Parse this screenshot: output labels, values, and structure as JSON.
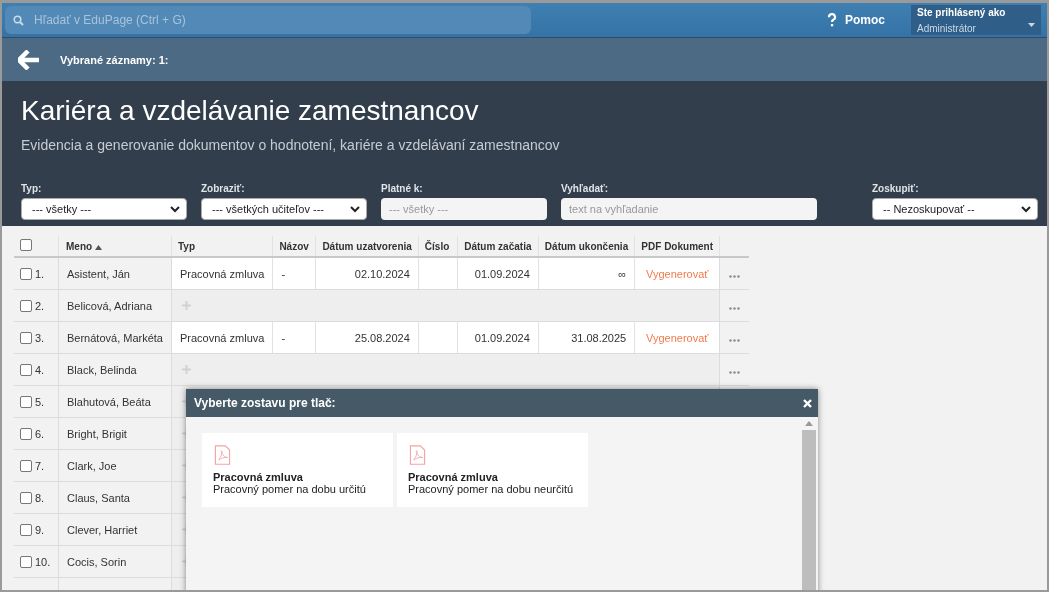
{
  "search": {
    "placeholder": "Hľadať v EduPage (Ctrl + G)"
  },
  "help": {
    "label": "Pomoc"
  },
  "user": {
    "heading": "Ste prihlásený ako",
    "role": "Administrátor"
  },
  "selection_bar": {
    "label": "Vybrané záznamy: 1:"
  },
  "page": {
    "title": "Kariéra a vzdelávanie zamestnancov",
    "subtitle": "Evidencia a generovanie dokumentov o hodnotení, kariére a vzdelávaní zamestnancov"
  },
  "filters": [
    {
      "label": "Typ:",
      "kind": "select",
      "value": "--- všetky ---"
    },
    {
      "label": "Zobraziť:",
      "kind": "select",
      "value": "--- všetkých učiteľov ---"
    },
    {
      "label": "Platné k:",
      "kind": "input",
      "placeholder": "--- všetky ---"
    },
    {
      "label": "Vyhľadať:",
      "kind": "input",
      "placeholder": "text na vyhľadanie"
    },
    {
      "label": "Zoskupiť:",
      "kind": "select",
      "value": "-- Nezoskupovať --"
    }
  ],
  "table": {
    "select_all_checked": false,
    "columns": [
      {
        "label": "Meno",
        "sorted": true
      },
      {
        "label": "Typ",
        "sorted": false
      },
      {
        "label": "Názov",
        "sorted": false
      },
      {
        "label": "Dátum uzatvorenia",
        "sorted": false
      },
      {
        "label": "Číslo",
        "sorted": false
      },
      {
        "label": "Dátum začatia",
        "sorted": false
      },
      {
        "label": "Dátum ukončenia",
        "sorted": false
      },
      {
        "label": "PDF Dokument",
        "sorted": false
      }
    ],
    "rows": [
      {
        "number": "1.",
        "name": "Asistent, Ján",
        "checked": false,
        "kind": "contract",
        "type": "Pracovná zmluva",
        "title": "-",
        "concluded": "02.10.2024",
        "start": "01.09.2024",
        "end": "∞",
        "pdf": "Vygenerovať"
      },
      {
        "number": "2.",
        "name": "Belicová, Adriana",
        "checked": false,
        "kind": "empty"
      },
      {
        "number": "3.",
        "name": "Bernátová, Markéta",
        "checked": false,
        "kind": "contract",
        "type": "Pracovná zmluva",
        "title": "-",
        "concluded": "25.08.2024",
        "start": "01.09.2024",
        "end": "31.08.2025",
        "pdf": "Vygenerovať"
      },
      {
        "number": "4.",
        "name": "Black, Belinda",
        "checked": false,
        "kind": "empty"
      },
      {
        "number": "5.",
        "name": "Blahutová, Beáta",
        "checked": false,
        "kind": "empty"
      },
      {
        "number": "6.",
        "name": "Bright, Brigit",
        "checked": false,
        "kind": "empty"
      },
      {
        "number": "7.",
        "name": "Clark, Joe",
        "checked": false,
        "kind": "empty"
      },
      {
        "number": "8.",
        "name": "Claus, Santa",
        "checked": false,
        "kind": "empty"
      },
      {
        "number": "9.",
        "name": "Clever, Harriet",
        "checked": false,
        "kind": "empty"
      },
      {
        "number": "10.",
        "name": "Cocis, Sorin",
        "checked": false,
        "kind": "empty"
      }
    ]
  },
  "print_dialog": {
    "title": "Vyberte zostavu pre tlač:",
    "reports": [
      {
        "title": "Pracovná zmluva",
        "description": "Pracovný pomer na dobu určitú"
      },
      {
        "title": "Pracovná zmluva",
        "description": "Pracovný pomer na dobu neurčitú"
      }
    ]
  }
}
